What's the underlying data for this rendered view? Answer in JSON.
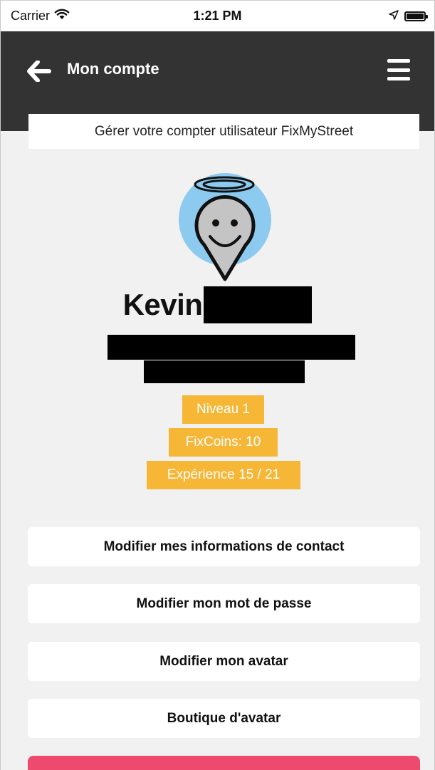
{
  "status_bar": {
    "carrier": "Carrier",
    "time": "1:21 PM",
    "battery_level": 1.0
  },
  "nav": {
    "title": "Mon compte",
    "back_icon": "arrow-left-icon",
    "menu_icon": "hamburger-icon"
  },
  "banner": {
    "text": "Gérer votre compter utilisateur FixMyStreet"
  },
  "profile": {
    "name_prefix": "Kevin",
    "avatar_icon": "angel-map-pin-avatar"
  },
  "badges": {
    "level": "Niveau 1",
    "fixcoins": "FixCoins: 10",
    "experience": "Expérience 15 / 21"
  },
  "actions": {
    "edit_contact": "Modifier mes informations de contact",
    "edit_password": "Modifier mon mot de passe",
    "edit_avatar": "Modifier mon avatar",
    "avatar_shop": "Boutique d'avatar"
  },
  "colors": {
    "nav_background": "#333333",
    "badge": "#f6b636",
    "logout_button": "#ee4a6e",
    "avatar_halo_background": "#8ccaf0",
    "page_background": "#f1f1f1"
  }
}
